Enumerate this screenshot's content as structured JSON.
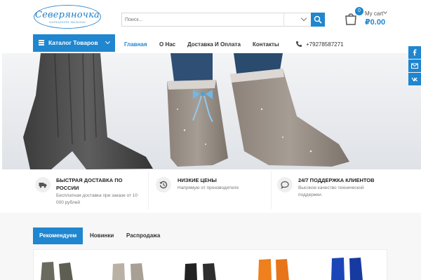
{
  "header": {
    "logo_title": "Северяночка",
    "logo_subtitle": "интернет-магазин",
    "search_placeholder": "Поиск...",
    "cart_count": "0",
    "cart_label": "My cart",
    "cart_total": "₽0.00"
  },
  "nav": {
    "catalog_label": "Каталог Товаров",
    "links": [
      "Главная",
      "О Нас",
      "Доставка И Оплата",
      "Контакты"
    ],
    "active_link": "Главная",
    "phone": "+79278587271"
  },
  "social": [
    "facebook-icon",
    "email-icon",
    "vk-icon"
  ],
  "features": [
    {
      "icon": "truck-icon",
      "title_line1": "БЫСТРАЯ ДОСТАВКА ПО",
      "title_line2": "РОССИИ",
      "desc_line1": "Бесплатная доставка при заказе от 10",
      "desc_line2": "000 рублей"
    },
    {
      "icon": "history-icon",
      "title_line1": "НИЗКИЕ ЦЕНЫ",
      "desc_line1": "Напрямую от производителя"
    },
    {
      "icon": "chat-icon",
      "title_line1": "24/7 ПОДДЕРЖКА КЛИЕНТОВ",
      "desc_line1": "Высокое качество технической",
      "desc_line2": "поддержки."
    }
  ],
  "tabs": [
    "Рекомендуем",
    "Новинки",
    "Распродажа"
  ],
  "colors": {
    "accent": "#1f86cf",
    "product_colors": [
      "#6b6a5e",
      "#b9b1a4",
      "#222222",
      "#f07f1d",
      "#1c45b8"
    ]
  }
}
